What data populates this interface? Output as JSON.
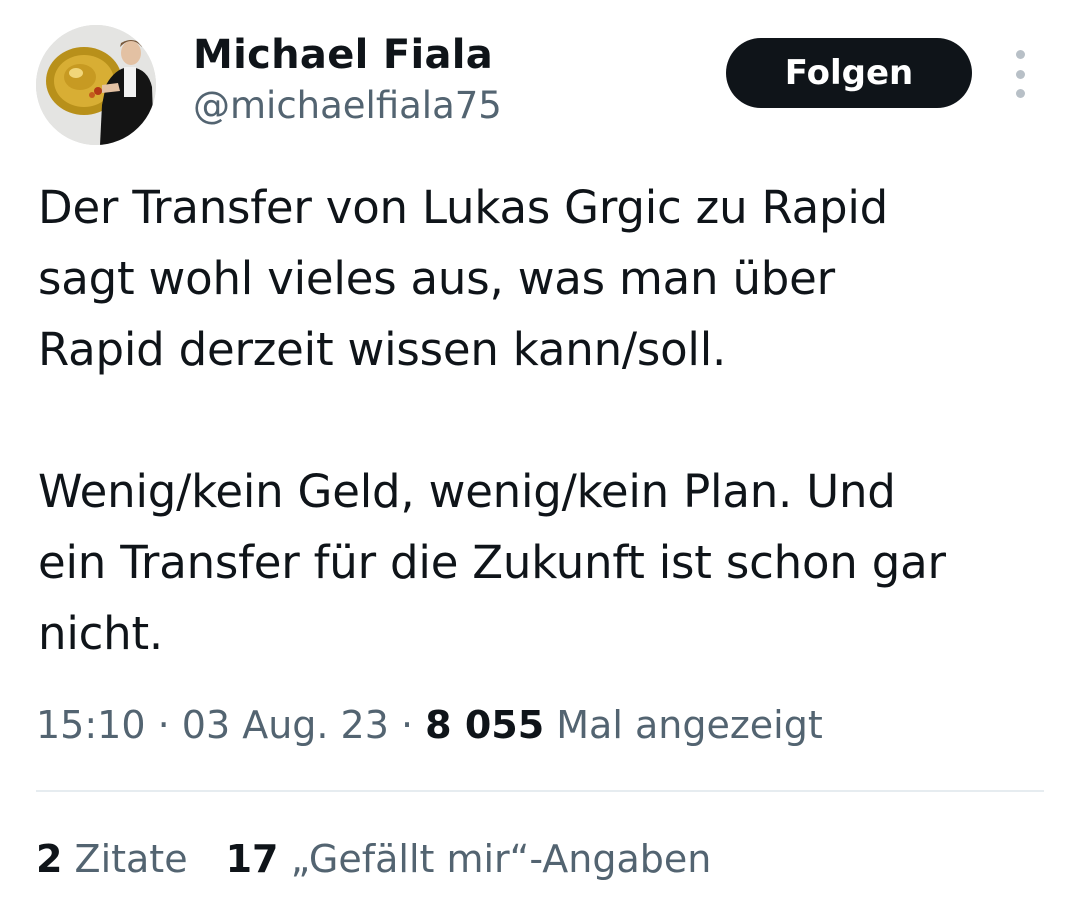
{
  "author": {
    "name": "Michael Fiala",
    "handle": "@michaelfiala75",
    "avatar_icon": "profile-photo"
  },
  "header": {
    "follow_label": "Folgen",
    "more_icon": "more-vertical-icon"
  },
  "tweet": {
    "text": "Der Transfer von Lukas Grgic zu Rapid\nsagt wohl vieles aus, was man über\nRapid derzeit wissen kann/soll.\n\nWenig/kein Geld, wenig/kein Plan. Und\nein Transfer für die Zukunft ist schon gar\nnicht."
  },
  "meta": {
    "time": "15:10",
    "separator": " · ",
    "date": "03 Aug. 23",
    "views_count": "8 055",
    "views_label": " Mal angezeigt"
  },
  "stats": {
    "quotes_count": "2",
    "quotes_label": " Zitate",
    "likes_count": "17",
    "likes_label": " „Gefällt mir“-Angaben"
  },
  "colors": {
    "text_primary": "#0f1419",
    "text_secondary": "#536471",
    "follow_button_bg": "#0f1419",
    "divider": "#e6ecf0"
  }
}
